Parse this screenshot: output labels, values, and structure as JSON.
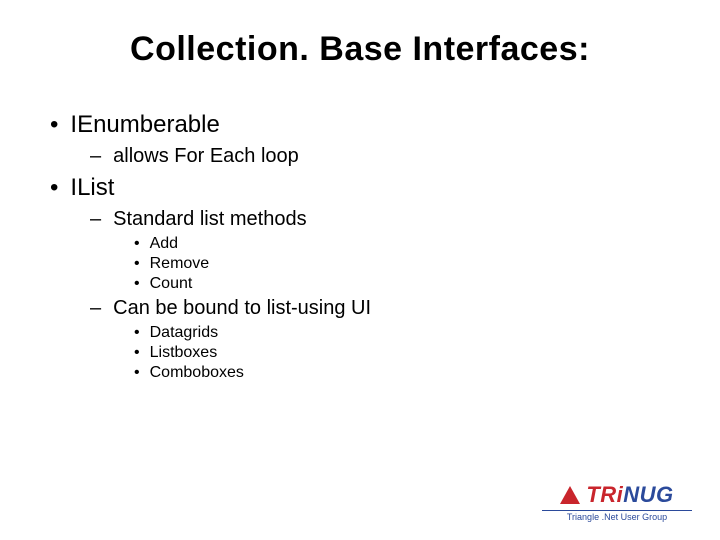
{
  "title": "Collection. Base Interfaces:",
  "bullets": {
    "lvl1": [
      {
        "text": "IEnumberable",
        "children": [
          {
            "text": "allows For Each loop",
            "children": []
          }
        ]
      },
      {
        "text": "IList",
        "children": [
          {
            "text": "Standard list methods",
            "children": [
              {
                "text": "Add"
              },
              {
                "text": "Remove"
              },
              {
                "text": "Count"
              }
            ]
          },
          {
            "text": "Can be bound to list-using UI",
            "children": [
              {
                "text": "Datagrids"
              },
              {
                "text": "Listboxes"
              },
              {
                "text": "Comboboxes"
              }
            ]
          }
        ]
      }
    ]
  },
  "bulletChars": {
    "lvl1": "•",
    "lvl2": "–",
    "lvl3": "•"
  },
  "logo": {
    "brand_tr": "TR",
    "brand_i": "i",
    "brand_nug": "NUG",
    "tagline": "Triangle .Net User Group"
  }
}
